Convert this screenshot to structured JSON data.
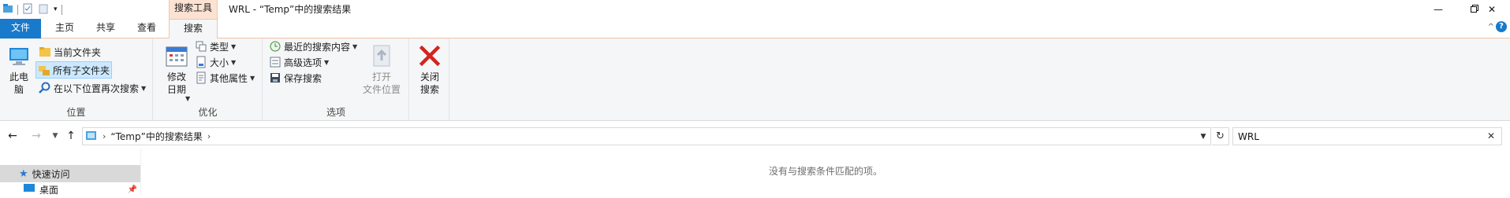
{
  "window": {
    "title": "WRL - “Temp”中的搜索结果",
    "contextual_group": "搜索工具"
  },
  "tabs": [
    {
      "label": "文件"
    },
    {
      "label": "主页"
    },
    {
      "label": "共享"
    },
    {
      "label": "查看"
    },
    {
      "label": "搜索"
    }
  ],
  "ribbon": {
    "location": {
      "label": "位置",
      "this_pc": "此电\n脑",
      "current_folder": "当前文件夹",
      "all_subfolders": "所有子文件夹",
      "search_again": "在以下位置再次搜索"
    },
    "refine": {
      "label": "优化",
      "date_modified": "修改\n日期",
      "kind": "类型",
      "size": "大小",
      "other_props": "其他属性"
    },
    "options": {
      "label": "选项",
      "recent_searches": "最近的搜索内容",
      "advanced": "高级选项",
      "save_search": "保存搜索",
      "open_location": "打开\n文件位置"
    },
    "close": {
      "label": "关闭\n搜索"
    }
  },
  "address": {
    "path": "“Temp”中的搜索结果",
    "search_value": "WRL"
  },
  "navpane": {
    "quick_access": "快速访问",
    "desktop": "桌面"
  },
  "content": {
    "empty_message": "没有与搜索条件匹配的项。"
  },
  "colors": {
    "accent": "#1979ca",
    "context_tab": "#fbe2d2",
    "close_red": "#d3241f"
  }
}
